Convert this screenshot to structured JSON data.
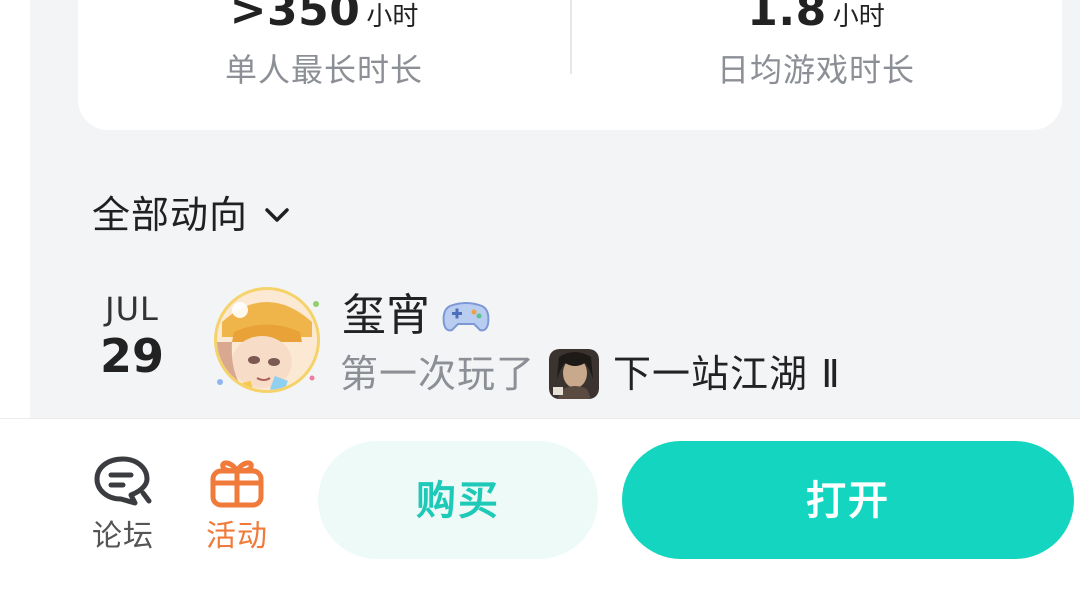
{
  "stats": {
    "longest": {
      "value": ">350",
      "unit": "小时",
      "label": "单人最长时长"
    },
    "daily": {
      "value": "1.8",
      "unit": "小时",
      "label": "日均游戏时长"
    }
  },
  "feed": {
    "filter_label": "全部动向",
    "filter_icon": "chevron-down-icon",
    "items": [
      {
        "date_month": "JUL",
        "date_day": "29",
        "user_name": "玺宵",
        "badge_icon": "gamepad-icon",
        "verb": "第一次玩了",
        "game_name": "下一站江湖 Ⅱ"
      }
    ]
  },
  "bottom_bar": {
    "forum_label": "论坛",
    "forum_icon": "chat-bubble-icon",
    "event_label": "活动",
    "event_icon": "gift-icon",
    "buy_label": "购买",
    "open_label": "打开"
  },
  "colors": {
    "accent": "#14d6c0",
    "accent_text": "#1ec9b7",
    "event_orange": "#f07a3a"
  }
}
